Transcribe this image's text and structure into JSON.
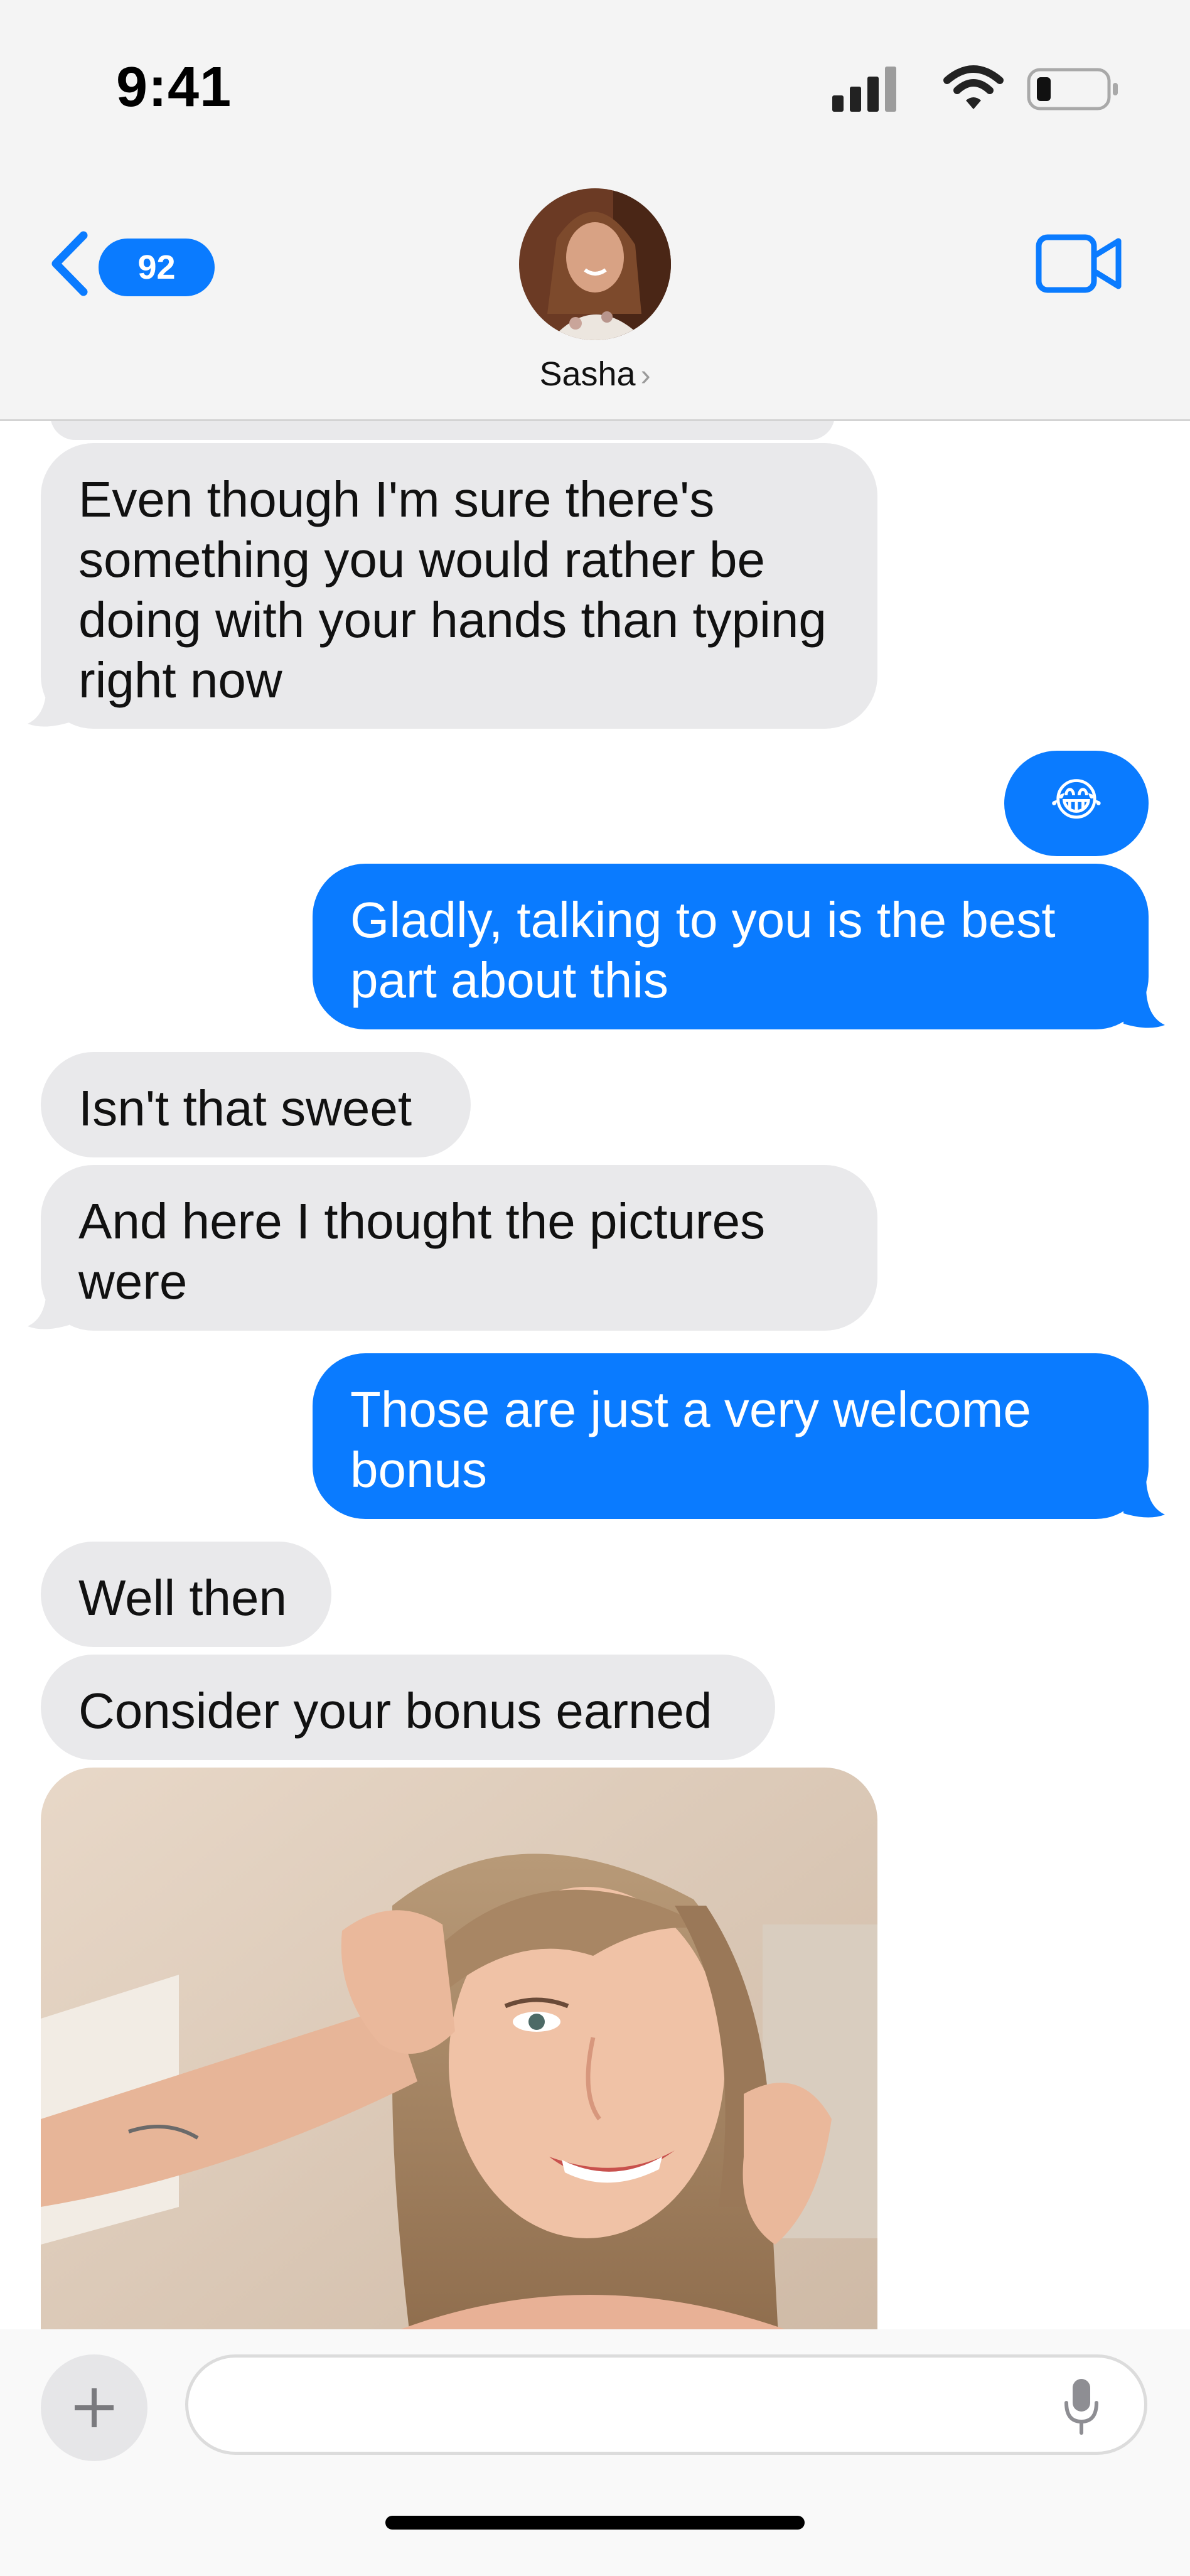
{
  "status_bar": {
    "time": "9:41"
  },
  "header": {
    "back_badge": "92",
    "contact_name": "Sasha",
    "chevron": "›",
    "video_icon": "video-camera-icon"
  },
  "messages": [
    {
      "from": "them",
      "text": "Even though I'm sure there's something you would rather be doing with your hands than typing right now"
    },
    {
      "from": "me",
      "text": "😂"
    },
    {
      "from": "me",
      "text": "Gladly, talking to you is the best part about this"
    },
    {
      "from": "them",
      "text": "Isn't that sweet"
    },
    {
      "from": "them",
      "text": "And here I thought the pictures were"
    },
    {
      "from": "me",
      "text": "Those are just a very welcome bonus"
    },
    {
      "from": "them",
      "text": "Well then"
    },
    {
      "from": "them",
      "text": "Consider your bonus earned"
    }
  ],
  "colors": {
    "outgoing_bubble": "#0a7bff",
    "incoming_bubble": "#e9e9eb",
    "header_bg": "#f4f4f4"
  },
  "input_bar": {
    "placeholder": ""
  }
}
